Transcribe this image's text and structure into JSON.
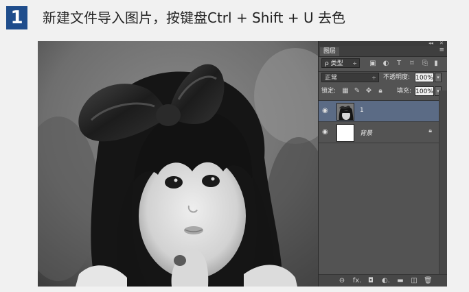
{
  "header": {
    "step_number": "1",
    "title": "新建文件导入图片，按键盘Ctrl + Shift + U 去色"
  },
  "photo": {
    "description_icon": "photo-icon"
  },
  "panel": {
    "topbar_collapse": "◂◂",
    "topbar_close": "✕",
    "tab_label": "图层",
    "tab_menu": "≡",
    "filter_select": "ρ 类型",
    "filter_arrow": "÷",
    "blend_mode": "正常",
    "blend_arrow": "÷",
    "opacity_label": "不透明度:",
    "opacity_value": "100%",
    "lock_label": "锁定:",
    "fill_label": "填充:",
    "fill_value": "100%",
    "stepper": "▾",
    "filter_icons": [
      "image-filter-icon",
      "adjustment-filter-icon",
      "text-filter-icon",
      "shape-filter-icon",
      "smart-object-filter-icon"
    ],
    "lock_icons": [
      "lock-transparent-icon",
      "lock-paint-icon",
      "lock-position-icon",
      "lock-all-icon"
    ],
    "layers": [
      {
        "name": "1",
        "selected": true,
        "visible_icon": "eye-icon"
      },
      {
        "name": "背景",
        "selected": false,
        "visible_icon": "eye-icon",
        "locked": true
      }
    ],
    "bottom_icons": [
      "link-icon",
      "fx-icon",
      "mask-icon",
      "adjustment-icon",
      "folder-icon",
      "new-layer-icon",
      "trash-icon"
    ],
    "bottom_glyphs": [
      "⊖",
      "fx.",
      "◘",
      "◐.",
      "▬",
      "◫",
      "🗑"
    ]
  },
  "colors": {
    "badge": "#1f4d8c",
    "panel_bg": "#535353",
    "selected_layer": "#5b6b85"
  }
}
